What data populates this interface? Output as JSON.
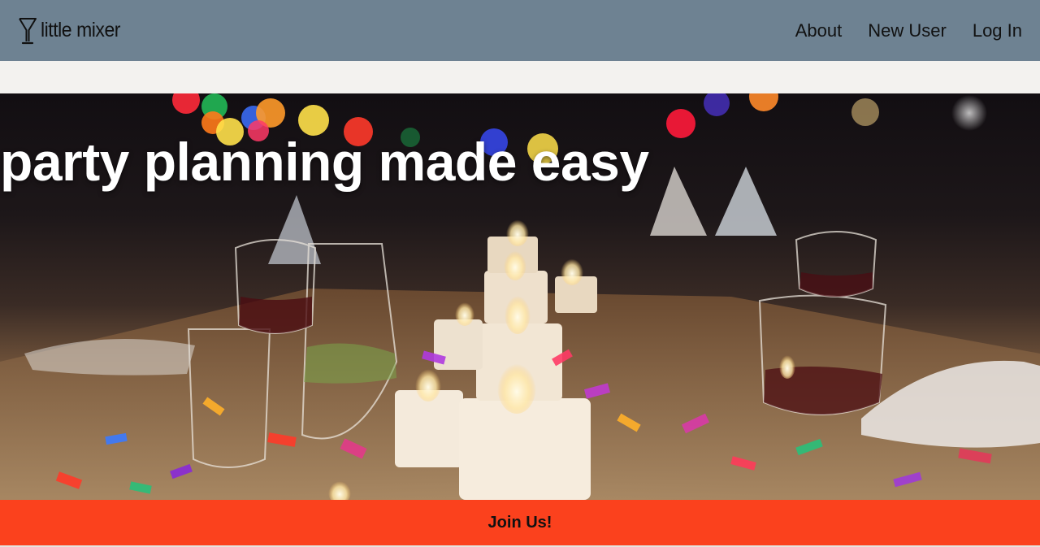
{
  "navbar": {
    "brand": {
      "name": "little mixer",
      "icon": "cocktail-glass-icon"
    },
    "links": [
      {
        "label": "About"
      },
      {
        "label": "New User"
      },
      {
        "label": "Log In"
      }
    ],
    "background_color": "#6e8292"
  },
  "hero": {
    "title": "party planning made easy",
    "image": "party table with candles, glasses and confetti"
  },
  "cta": {
    "label": "Join Us!",
    "color": "#fb411d"
  }
}
